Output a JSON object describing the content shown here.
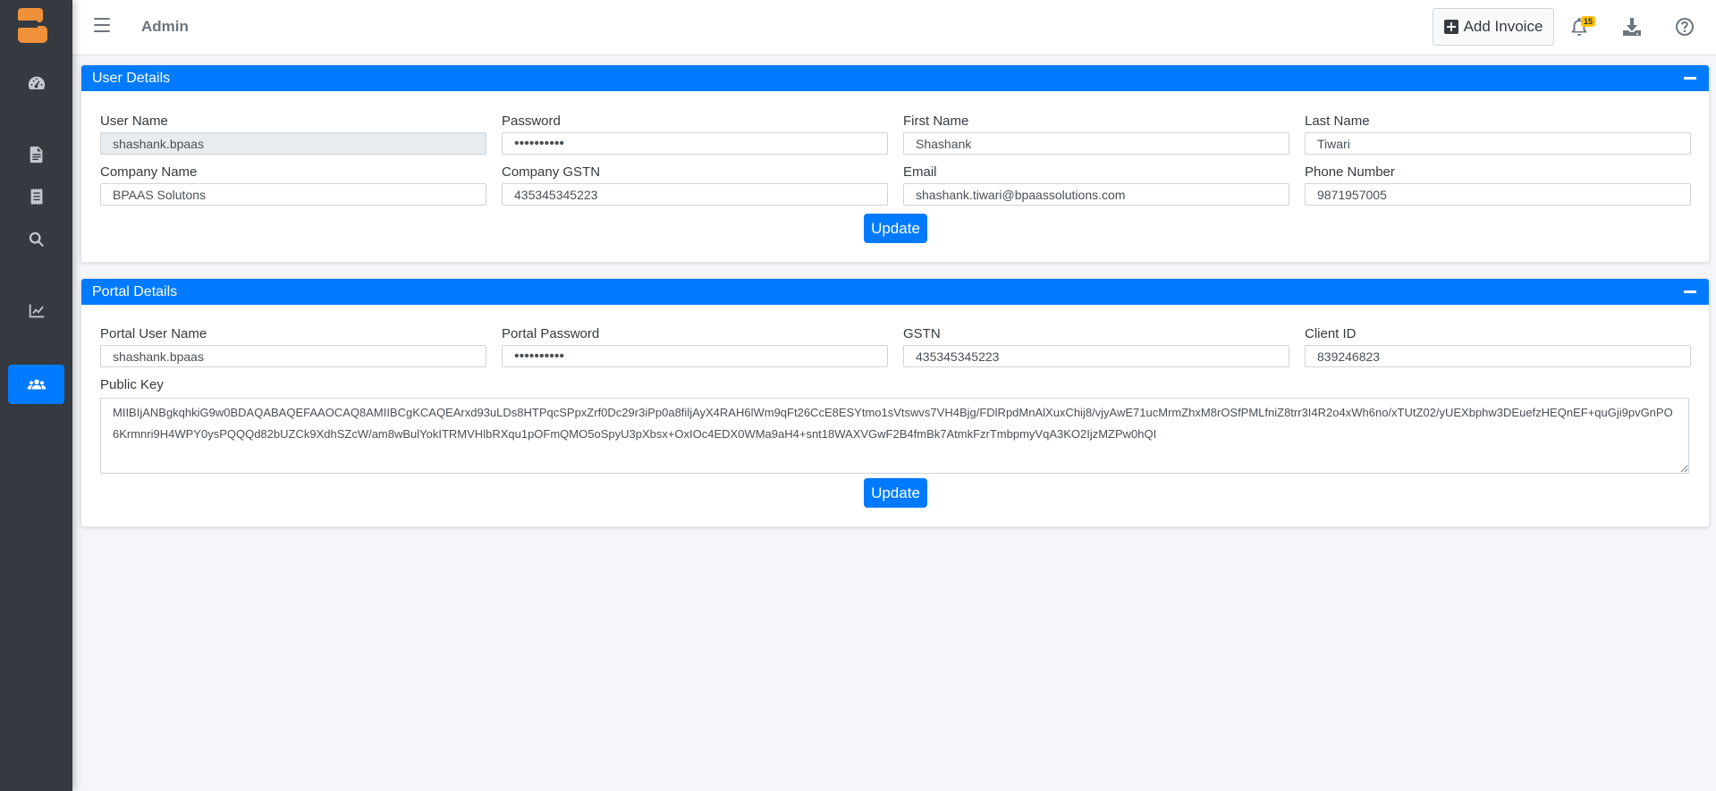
{
  "app": {
    "logo": "B"
  },
  "sidebar": {
    "items": [
      {
        "icon": "dashboard-icon"
      },
      {
        "icon": "document-icon"
      },
      {
        "icon": "receipt-icon"
      },
      {
        "icon": "search-icon"
      },
      {
        "icon": "chart-icon"
      },
      {
        "icon": "users-icon",
        "active": true
      }
    ]
  },
  "header": {
    "breadcrumb": "Admin",
    "add_invoice_label": "Add Invoice",
    "notification_count": "15"
  },
  "user_details": {
    "title": "User Details",
    "fields": {
      "user_name": {
        "label": "User Name",
        "value": "shashank.bpaas"
      },
      "password": {
        "label": "Password",
        "value": "••••••••••"
      },
      "first_name": {
        "label": "First Name",
        "value": "Shashank"
      },
      "last_name": {
        "label": "Last Name",
        "value": "Tiwari"
      },
      "company_name": {
        "label": "Company Name",
        "value": "BPAAS Solutons"
      },
      "company_gstn": {
        "label": "Company GSTN",
        "value": "435345345223"
      },
      "email": {
        "label": "Email",
        "value": "shashank.tiwari@bpaassolutions.com"
      },
      "phone": {
        "label": "Phone Number",
        "value": "9871957005"
      }
    },
    "update_label": "Update"
  },
  "portal_details": {
    "title": "Portal Details",
    "fields": {
      "portal_user_name": {
        "label": "Portal User Name",
        "value": "shashank.bpaas"
      },
      "portal_password": {
        "label": "Portal Password",
        "value": "••••••••••"
      },
      "gstn": {
        "label": "GSTN",
        "value": "435345345223"
      },
      "client_id": {
        "label": "Client ID",
        "value": "839246823"
      },
      "public_key": {
        "label": "Public Key",
        "value": "MIIBIjANBgkqhkiG9w0BDAQABAQEFAAOCAQ8AMIIBCgKCAQEArxd93uLDs8HTPqcSPpxZrf0Dc29r3iPp0a8filjAyX4RAH6lWm9qFt26CcE8ESYtmo1sVtswvs7VH4Bjg/FDlRpdMnAlXuxChij8/vjyAwE71ucMrmZhxM8rOSfPMLfniZ8trr3I4R2o4xWh6no/xTUtZ02/yUEXbphw3DEuefzHEQnEF+quGji9pvGnPO6Krmnri9H4WPY0ysPQQQd82bUZCk9XdhSZcW/am8wBulYokITRMVHlbRXqu1pOFmQMO5oSpyU3pXbsx+OxIOc4EDX0WMa9aH4+snt18WAXVGwF2B4fmBk7AtmkFzrTmbpmyVqA3KO2IjzMZPw0hQI"
      }
    },
    "update_label": "Update"
  },
  "colors": {
    "primary": "#007bff",
    "sidebar": "#343a40",
    "badge": "#ffc107",
    "logo": "#f0913a"
  }
}
